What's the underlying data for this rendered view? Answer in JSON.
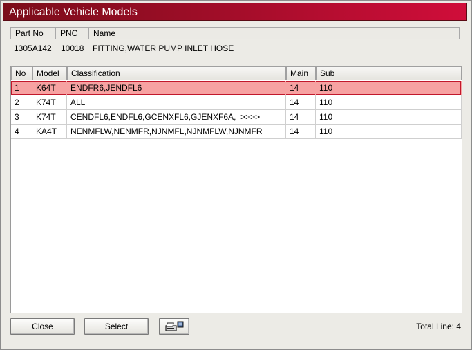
{
  "window": {
    "title": "Applicable Vehicle Models"
  },
  "part_info": {
    "headers": {
      "part_no": "Part No",
      "pnc": "PNC",
      "name": "Name"
    },
    "values": {
      "part_no": "1305A142",
      "pnc": "10018",
      "name": "FITTING,WATER PUMP INLET HOSE"
    }
  },
  "table": {
    "columns": [
      "No",
      "Model",
      "Classification",
      "Main",
      "Sub"
    ],
    "rows": [
      {
        "no": "1",
        "model": "K64T",
        "classification": "ENDFR6,JENDFL6",
        "main": "14",
        "sub": "110",
        "selected": true
      },
      {
        "no": "2",
        "model": "K74T",
        "classification": "ALL",
        "main": "14",
        "sub": "110",
        "selected": false
      },
      {
        "no": "3",
        "model": "K74T",
        "classification": "CENDFL6,ENDFL6,GCENXFL6,GJENXF6A,  >>>>",
        "main": "14",
        "sub": "110",
        "selected": false
      },
      {
        "no": "4",
        "model": "KA4T",
        "classification": "NENMFLW,NENMFR,NJNMFL,NJNMFLW,NJNMFR",
        "main": "14",
        "sub": "110",
        "selected": false
      }
    ]
  },
  "buttons": {
    "close": "Close",
    "select": "Select",
    "print_icon": "printer-icon"
  },
  "status": {
    "total_line": "Total Line: 4"
  },
  "colors": {
    "title_start": "#7b0d1a",
    "title_end": "#d00d3a",
    "selected_row": "#f7a2a2",
    "selected_border": "#c2182b"
  }
}
